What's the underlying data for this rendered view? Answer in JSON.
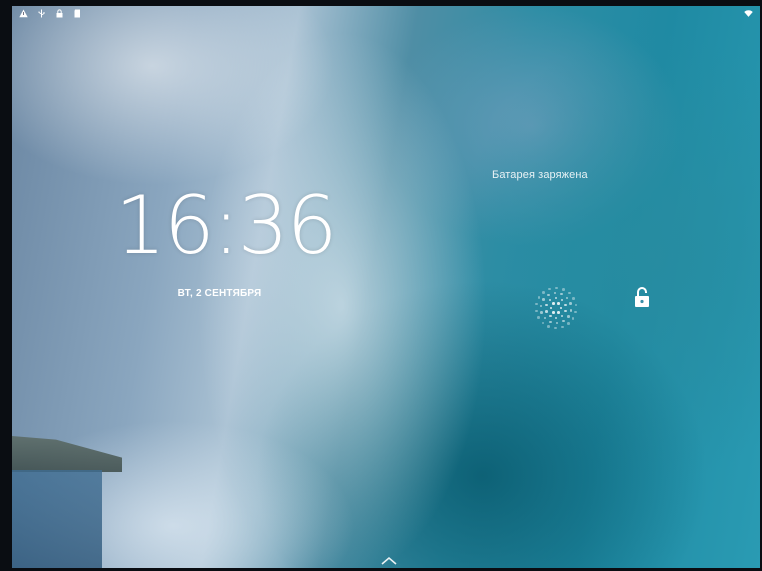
{
  "status_bar": {
    "left_icons": [
      "warning-icon",
      "usb-icon",
      "lock-icon",
      "sd-card-icon"
    ],
    "right_icons": [
      "wifi-icon"
    ]
  },
  "lockscreen": {
    "time": "16:36",
    "date": "ВТ, 2 СЕНТЯБРЯ",
    "battery_status": "Батарея заряжена",
    "unlock_target_icon": "unlock-icon",
    "swipe_icon": "chevron-up-icon"
  },
  "colors": {
    "text": "#ffffff"
  }
}
